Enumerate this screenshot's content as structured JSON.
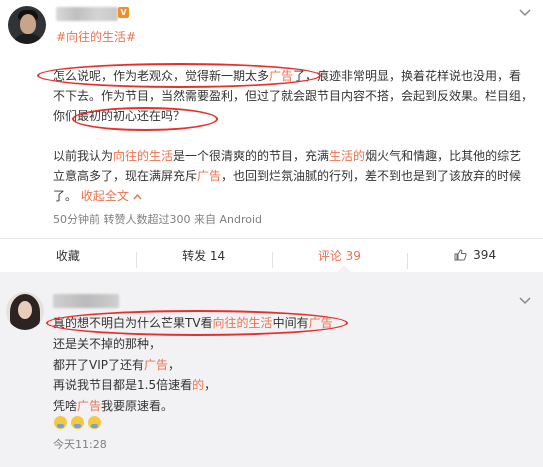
{
  "colors": {
    "accent": "#eb7350",
    "link": "#eb7350",
    "annotation": "#e8302b",
    "comment_bg": "#f2f2f5",
    "vip_badge": "#f28d2a"
  },
  "post": {
    "vip_badge": "V",
    "topic": "#向往的生活#",
    "para1": {
      "a": "怎么说呢，作为老观众，觉得新一期太多",
      "b": "广告",
      "c": "了，痕迹非常明显，换着花样说也没用，看不下去。作为节目，当然需要盈利，但过了就会跟节目内容不搭，会起到反效果。栏目组，你们最初的初心还在吗？"
    },
    "para2": {
      "a": "以前我认为",
      "b": "向往的生活",
      "c": "是一个很清爽的的节目，充满",
      "d": "生活的",
      "e": "烟火气和情趣，比其他的综艺立意高多了，现在满屏充斥",
      "f": "广告",
      "g": "，也回到烂氛油腻的行列，差不到也是到了该放弃的时候了。",
      "collapse": "收起全文",
      "collapse_icon": "chevron-up-icon"
    },
    "meta": "50分钟前 转赞人数超过300 来自 Android",
    "actions": {
      "favorite": "收藏",
      "repost": "转发 14",
      "comment": "评论 39",
      "like_count": "394",
      "like_icon": "thumbs-up-icon"
    }
  },
  "comment": {
    "line1": {
      "a": "真的想不明白为什么芒果TV看",
      "b": "向往的生活",
      "c": "中间有",
      "d": "广告"
    },
    "line2": "还是关不掉的那种，",
    "line3": {
      "a": "都开了VIP了还有",
      "b": "广告",
      "c": "，"
    },
    "line4": {
      "a": "再说我节目都是1.5倍速看",
      "b": "的",
      "c": "，"
    },
    "line5": {
      "a": "凭啥",
      "b": "广告",
      "c": "我要原速看。"
    },
    "emoji_icon": "crying-face-icon",
    "time": "今天11:28"
  }
}
